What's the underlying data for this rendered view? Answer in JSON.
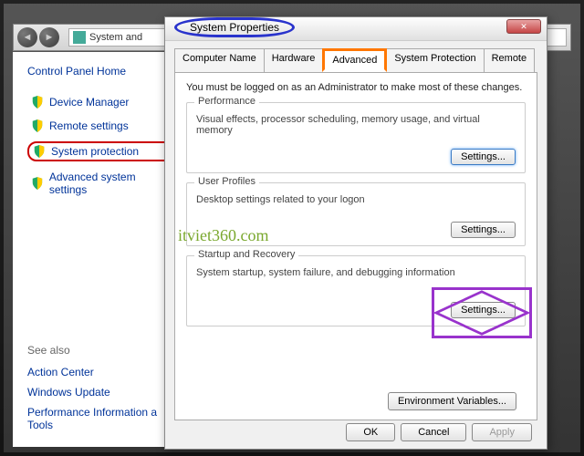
{
  "toolbar": {
    "address_text": "System and"
  },
  "sidebar": {
    "home": "Control Panel Home",
    "links": [
      {
        "label": "Device Manager"
      },
      {
        "label": "Remote settings"
      },
      {
        "label": "System protection"
      },
      {
        "label": "Advanced system settings"
      }
    ],
    "see_also_title": "See also",
    "see_also": [
      "Action Center",
      "Windows Update",
      "Performance Information a Tools"
    ]
  },
  "dialog": {
    "title": "System Properties",
    "close": "✕",
    "tabs": [
      "Computer Name",
      "Hardware",
      "Advanced",
      "System Protection",
      "Remote"
    ],
    "intro": "You must be logged on as an Administrator to make most of these changes.",
    "groups": {
      "performance": {
        "title": "Performance",
        "desc": "Visual effects, processor scheduling, memory usage, and virtual memory",
        "btn": "Settings..."
      },
      "profiles": {
        "title": "User Profiles",
        "desc": "Desktop settings related to your logon",
        "btn": "Settings..."
      },
      "startup": {
        "title": "Startup and Recovery",
        "desc": "System startup, system failure, and debugging information",
        "btn": "Settings..."
      }
    },
    "env_btn": "Environment Variables...",
    "ok": "OK",
    "cancel": "Cancel",
    "apply": "Apply"
  },
  "watermark": "itviet360.com"
}
